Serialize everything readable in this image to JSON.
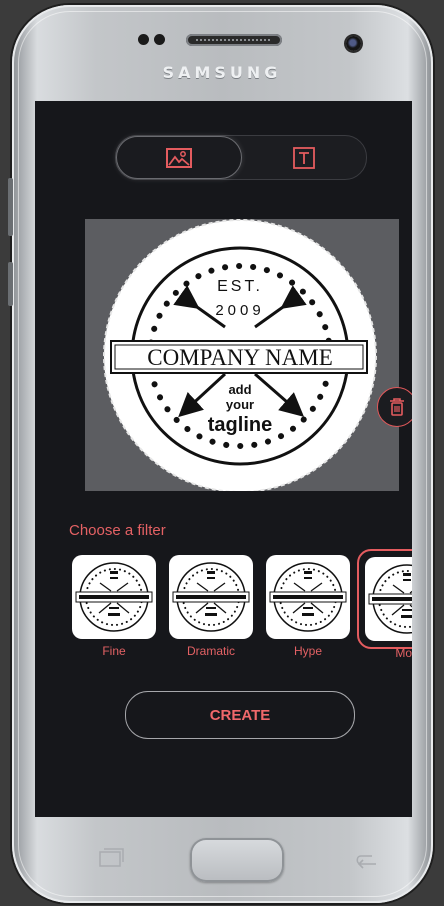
{
  "device": {
    "brand": "SAMSUNG"
  },
  "mode_toggle": {
    "options": [
      {
        "icon": "image-icon",
        "active": true
      },
      {
        "icon": "text-icon",
        "active": false
      }
    ]
  },
  "logo": {
    "established": "EST.",
    "year": "2009",
    "company": "COMPANY NAME",
    "tagline_line1": "add",
    "tagline_line2": "your",
    "tagline_line3": "tagline"
  },
  "filters": {
    "heading": "Choose a filter",
    "items": [
      {
        "label": "Fine"
      },
      {
        "label": "Dramatic"
      },
      {
        "label": "Hype"
      },
      {
        "label": "Moo"
      }
    ]
  },
  "actions": {
    "create_label": "CREATE"
  },
  "colors": {
    "accent": "#e45c5f",
    "screen_bg": "#16171b",
    "preview_bg": "#5c5d61"
  }
}
